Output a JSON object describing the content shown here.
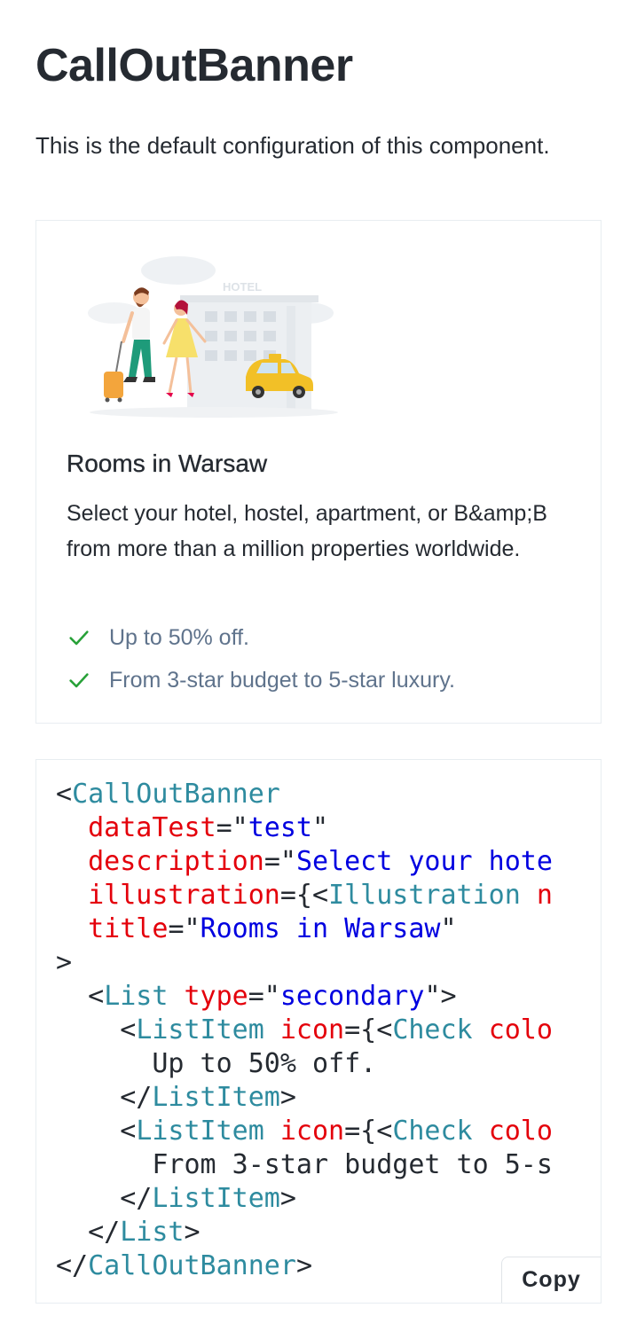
{
  "page": {
    "title": "CallOutBanner",
    "description": "This is the default configuration of this component."
  },
  "banner": {
    "title": "Rooms in Warsaw",
    "description": "Select your hotel, hostel, apartment, or B&amp;B from more than a million properties worldwide.",
    "illustration_sign": "HOTEL",
    "list": [
      {
        "icon": "check-icon",
        "text": "Up to 50% off."
      },
      {
        "icon": "check-icon",
        "text": "From 3-star budget to 5-star luxury."
      }
    ]
  },
  "code": {
    "lines": [
      [
        [
          "punc",
          "<"
        ],
        [
          "tag",
          "CallOutBanner"
        ]
      ],
      [
        [
          "punc",
          "  "
        ],
        [
          "attr",
          "dataTest"
        ],
        [
          "punc",
          "=\""
        ],
        [
          "str",
          "test"
        ],
        [
          "punc",
          "\""
        ]
      ],
      [
        [
          "punc",
          "  "
        ],
        [
          "attr",
          "description"
        ],
        [
          "punc",
          "=\""
        ],
        [
          "str",
          "Select your hote"
        ]
      ],
      [
        [
          "punc",
          "  "
        ],
        [
          "attr",
          "illustration"
        ],
        [
          "punc",
          "={<"
        ],
        [
          "tag",
          "Illustration "
        ],
        [
          "attr",
          "n"
        ]
      ],
      [
        [
          "punc",
          "  "
        ],
        [
          "attr",
          "title"
        ],
        [
          "punc",
          "=\""
        ],
        [
          "str",
          "Rooms in Warsaw"
        ],
        [
          "punc",
          "\""
        ]
      ],
      [
        [
          "punc",
          ">"
        ]
      ],
      [
        [
          "punc",
          "  <"
        ],
        [
          "tag",
          "List "
        ],
        [
          "attr",
          "type"
        ],
        [
          "punc",
          "=\""
        ],
        [
          "str",
          "secondary"
        ],
        [
          "punc",
          "\">"
        ]
      ],
      [
        [
          "punc",
          "    <"
        ],
        [
          "tag",
          "ListItem "
        ],
        [
          "attr",
          "icon"
        ],
        [
          "punc",
          "={<"
        ],
        [
          "tag",
          "Check "
        ],
        [
          "attr",
          "colo"
        ]
      ],
      [
        [
          "punc",
          "      Up to 50% off."
        ]
      ],
      [
        [
          "punc",
          "    </"
        ],
        [
          "tag",
          "ListItem"
        ],
        [
          "punc",
          ">"
        ]
      ],
      [
        [
          "punc",
          "    <"
        ],
        [
          "tag",
          "ListItem "
        ],
        [
          "attr",
          "icon"
        ],
        [
          "punc",
          "={<"
        ],
        [
          "tag",
          "Check "
        ],
        [
          "attr",
          "colo"
        ]
      ],
      [
        [
          "punc",
          "      From 3-star budget to 5-s"
        ]
      ],
      [
        [
          "punc",
          "    </"
        ],
        [
          "tag",
          "ListItem"
        ],
        [
          "punc",
          ">"
        ]
      ],
      [
        [
          "punc",
          "  </"
        ],
        [
          "tag",
          "List"
        ],
        [
          "punc",
          ">"
        ]
      ],
      [
        [
          "punc",
          "</"
        ],
        [
          "tag",
          "CallOutBanner"
        ],
        [
          "punc",
          ">"
        ]
      ]
    ],
    "copy_label": "Copy"
  },
  "colors": {
    "check": "#28a138",
    "tag": "#2e8b9f",
    "attr": "#e4000b",
    "string": "#0000e0"
  }
}
